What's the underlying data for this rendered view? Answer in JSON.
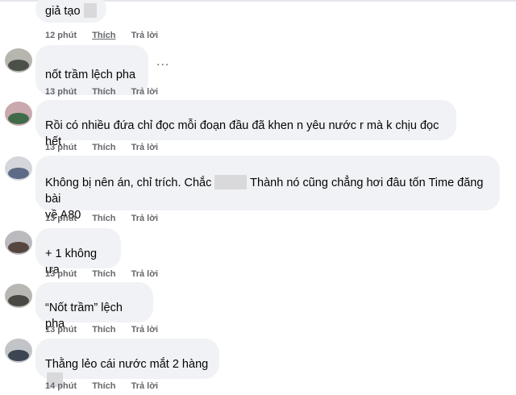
{
  "comments": [
    {
      "text_before": "giả tạo",
      "has_censor": true,
      "time": "12 phút",
      "like": "Thích",
      "reply": "Trả lời"
    },
    {
      "text": "nốt trầm lệch pha .",
      "time": "13 phút",
      "like": "Thích",
      "reply": "Trả lời"
    },
    {
      "text": "Rồi có nhiều đứa chỉ đọc mỗi đoạn đầu đã khen n yêu nước r mà k chịu đọc hết",
      "time": "13 phút",
      "like": "Thích",
      "reply": "Trả lời"
    },
    {
      "text_a": "Không bị nên án, chỉ trích. Chắc",
      "text_b": "Thành nó cũng chẳng hơi đâu tốn Time đăng bài",
      "text_c": "về A80",
      "time": "13 phút",
      "like": "Thích",
      "reply": "Trả lời"
    },
    {
      "text": "+ 1 không ưa",
      "time": "13 phút",
      "like": "Thích",
      "reply": "Trả lời"
    },
    {
      "text": "“Nốt trầm” lệch pha",
      "time": "13 phút",
      "like": "Thích",
      "reply": "Trả lời"
    },
    {
      "text": "Thằng lẻo cái nước mắt 2 hàng",
      "time": "14 phút",
      "like": "Thích",
      "reply": "Trả lời"
    }
  ],
  "more_label": "...",
  "colors": {
    "bubble": "#f0f2f5",
    "meta": "#65676b",
    "text": "#050505"
  }
}
